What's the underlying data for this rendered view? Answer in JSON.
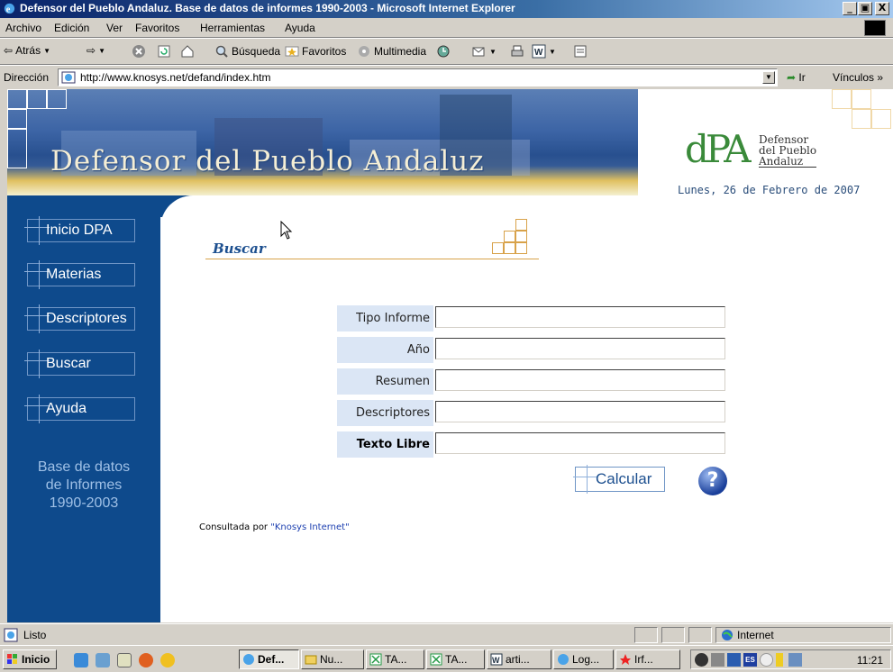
{
  "window": {
    "title": "Defensor del Pueblo Andaluz. Base de datos de informes 1990-2003 - Microsoft Internet Explorer",
    "min": "_",
    "max": "▣",
    "close": "X"
  },
  "menu": [
    "Archivo",
    "Edición",
    "Ver",
    "Favoritos",
    "Herramientas",
    "Ayuda"
  ],
  "toolbar": {
    "back": "Atrás",
    "search": "Búsqueda",
    "favorites": "Favoritos",
    "multimedia": "Multimedia"
  },
  "address": {
    "label": "Dirección",
    "url": "http://www.knosys.net/defand/index.htm",
    "go": "Ir",
    "links": "Vínculos »"
  },
  "banner": {
    "title": "Defensor del Pueblo Andaluz",
    "logo_mark": "dPA",
    "logo_line1": "Defensor",
    "logo_line2": "del Pueblo",
    "logo_line3": "Andaluz",
    "date": "Lunes, 26 de Febrero de 2007"
  },
  "nav": {
    "items": [
      "Inicio DPA",
      "Materias",
      "Descriptores",
      "Buscar",
      "Ayuda"
    ],
    "info": [
      "Base de datos",
      "de Informes",
      "1990-2003"
    ]
  },
  "search": {
    "title": "Buscar",
    "fields": [
      {
        "label": "Tipo Informe",
        "value": ""
      },
      {
        "label": "Año",
        "value": ""
      },
      {
        "label": "Resumen",
        "value": ""
      },
      {
        "label": "Descriptores",
        "value": ""
      },
      {
        "label": "Texto Libre",
        "value": ""
      }
    ],
    "submit": "Calcular",
    "help": "?",
    "consulted_prefix": "Consultada por ",
    "consulted_link": "\"Knosys Internet\""
  },
  "status": {
    "text": "Listo",
    "zone": "Internet"
  },
  "taskbar": {
    "start": "Inicio",
    "tasks": [
      "Def...",
      "Nu...",
      "TA...",
      "TA...",
      "arti...",
      "Log...",
      "Irf..."
    ],
    "lang": "ES",
    "clock": "11:21"
  },
  "colors": {
    "nav_bg": "#0e4a8c",
    "accent": "#1c4f8f",
    "gold": "#d8a24a",
    "label_bg": "#dbe6f5"
  }
}
